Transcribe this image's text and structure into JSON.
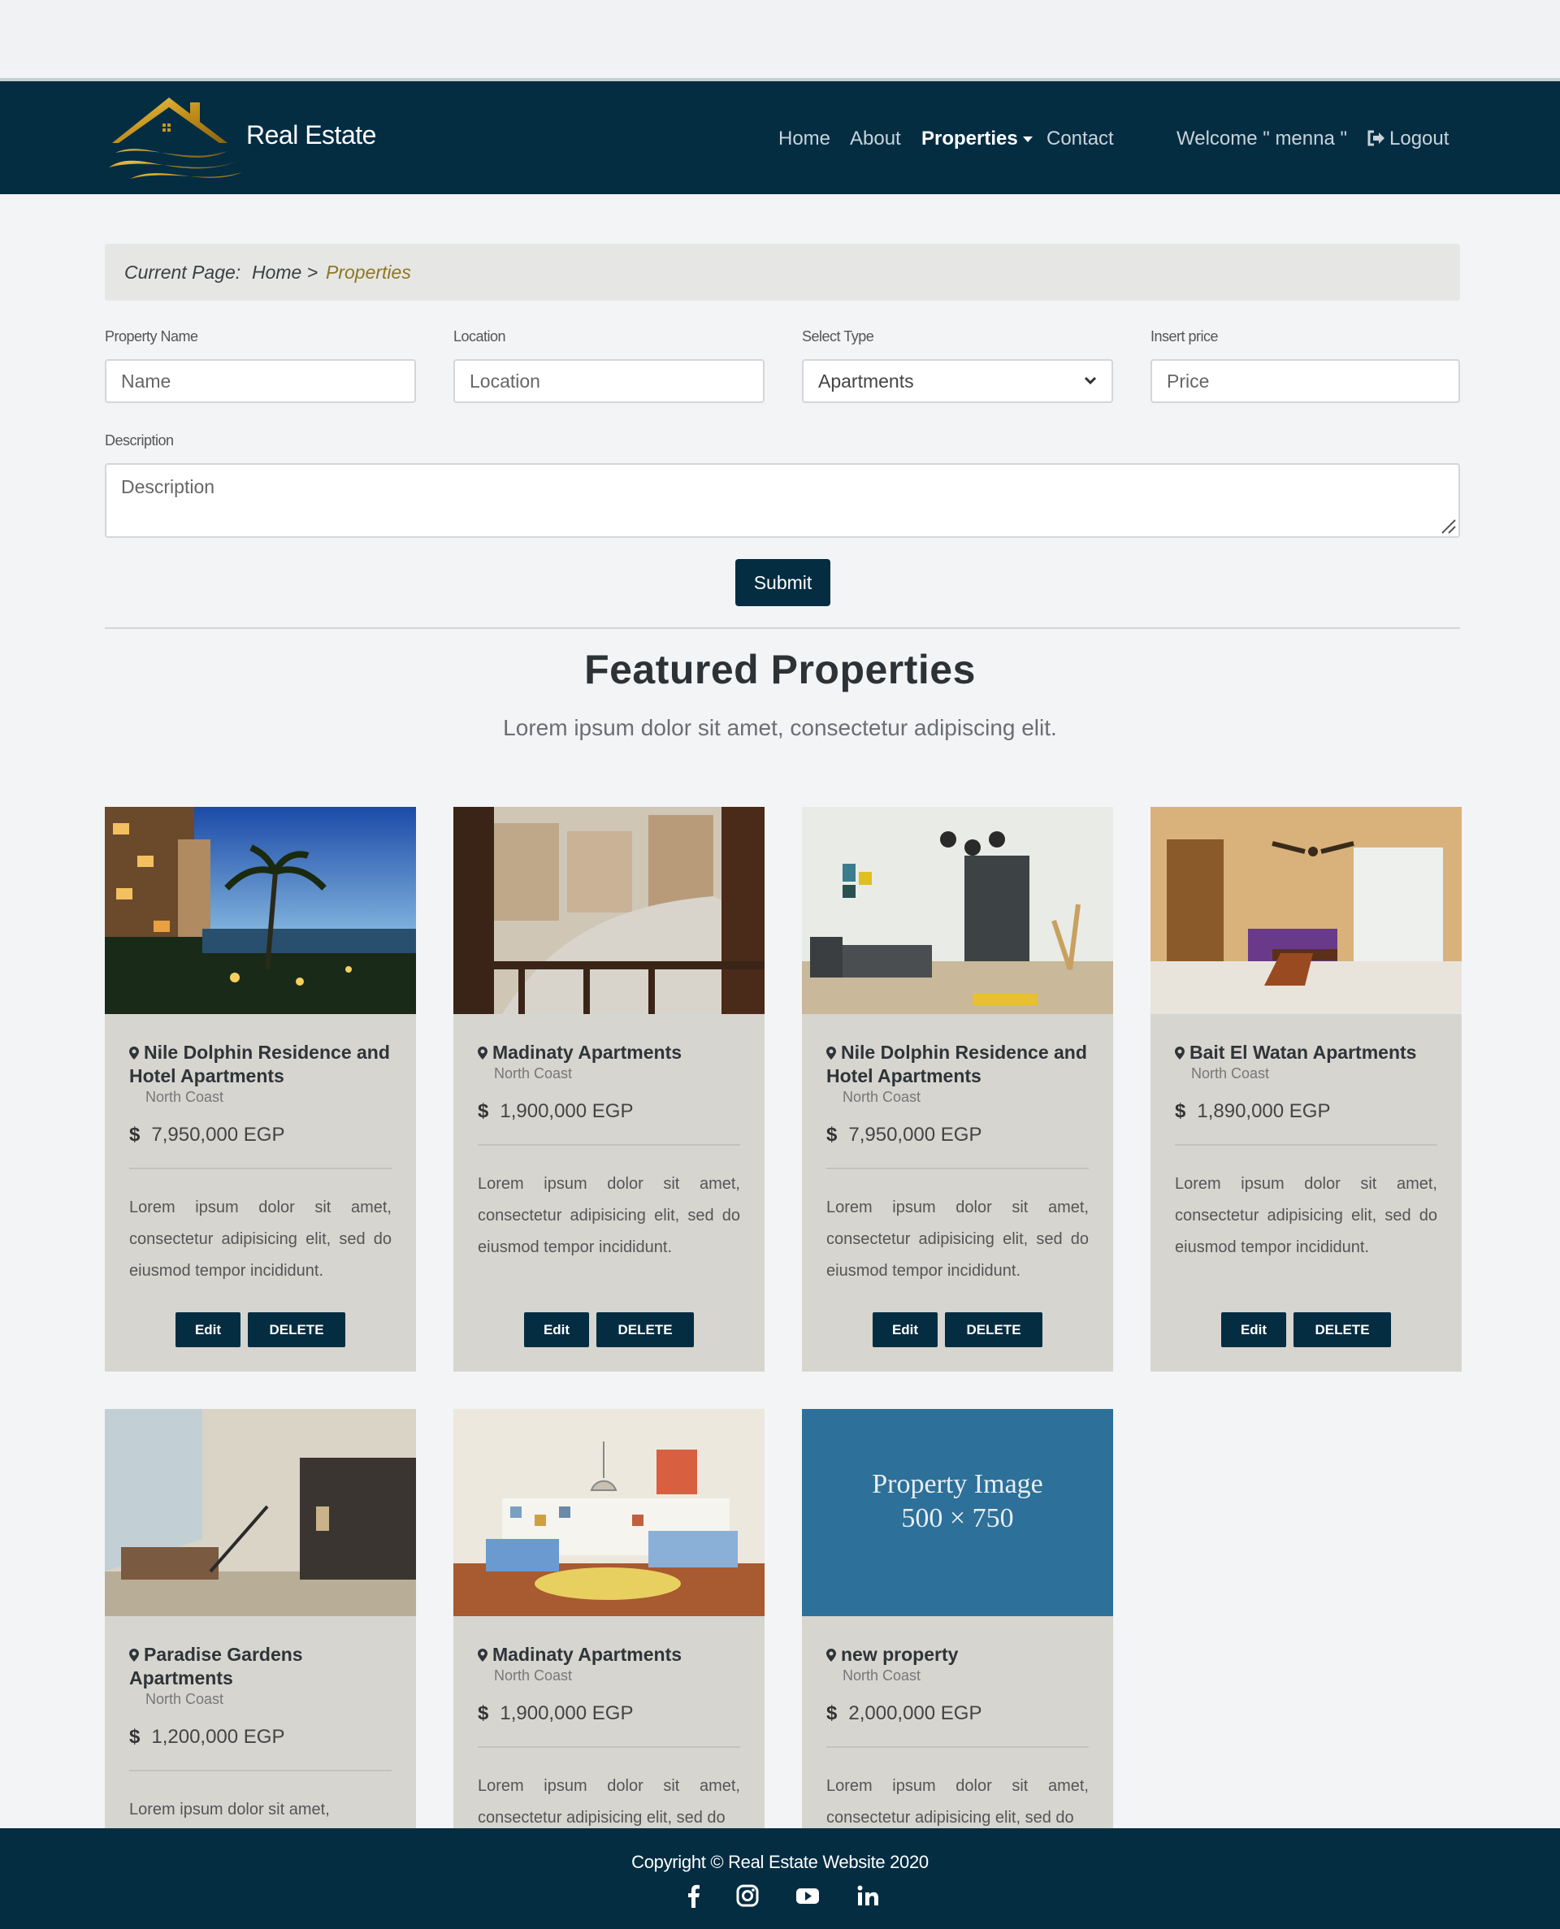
{
  "header": {
    "brand": "Real Estate",
    "nav": [
      "Home",
      "About",
      "Properties",
      "Contact"
    ],
    "welcome": "Welcome \" menna \"",
    "logout": "Logout"
  },
  "breadcrumb": {
    "prefix": "Current Page:",
    "home": "Home >",
    "current": "Properties"
  },
  "form": {
    "name_label": "Property Name",
    "name_placeholder": "Name",
    "location_label": "Location",
    "location_placeholder": "Location",
    "type_label": "Select Type",
    "type_value": "Apartments",
    "price_label": "Insert price",
    "price_placeholder": "Price",
    "description_label": "Description",
    "description_placeholder": "Description",
    "submit": "Submit"
  },
  "section": {
    "title": "Featured Properties",
    "subtitle": "Lorem ipsum dolor sit amet, consectetur adipiscing elit."
  },
  "cards": [
    {
      "title": "Nile Dolphin Residence and Hotel Apartments",
      "location": "North Coast",
      "price": "7,950,000 EGP",
      "desc": "Lorem ipsum dolor sit amet, consectetur adipisicing elit, sed do eiusmod tempor incididunt.",
      "edit": "Edit",
      "delete": "DELETE"
    },
    {
      "title": "Madinaty Apartments",
      "location": "North Coast",
      "price": "1,900,000 EGP",
      "desc": "Lorem ipsum dolor sit amet, consectetur adipisicing elit, sed do eiusmod tempor incididunt.",
      "edit": "Edit",
      "delete": "DELETE"
    },
    {
      "title": "Nile Dolphin Residence and Hotel Apartments",
      "location": "North Coast",
      "price": "7,950,000 EGP",
      "desc": "Lorem ipsum dolor sit amet, consectetur adipisicing elit, sed do eiusmod tempor incididunt.",
      "edit": "Edit",
      "delete": "DELETE"
    },
    {
      "title": "Bait El Watan Apartments",
      "location": "North Coast",
      "price": "1,890,000 EGP",
      "desc": "Lorem ipsum dolor sit amet, consectetur adipisicing elit, sed do eiusmod tempor incididunt.",
      "edit": "Edit",
      "delete": "DELETE"
    },
    {
      "title": "Paradise Gardens Apartments",
      "location": "North Coast",
      "price": "1,200,000 EGP",
      "desc": "Lorem ipsum dolor sit amet,"
    },
    {
      "title": "Madinaty Apartments",
      "location": "North Coast",
      "price": "1,900,000 EGP",
      "desc": "Lorem ipsum dolor sit amet, consectetur adipisicing elit, sed do"
    },
    {
      "title": "new property",
      "location": "North Coast",
      "price": "2,000,000 EGP",
      "desc": "Lorem ipsum dolor sit amet, consectetur adipisicing elit, sed do",
      "image_text": [
        "Property Image",
        "500 × 750"
      ]
    }
  ],
  "currency_symbol": "$",
  "footer": {
    "copyright": "Copyright © Real Estate Website 2020"
  },
  "colors": {
    "navy": "#042d42",
    "gold": "#c79a1e",
    "card": "#d6d5d0",
    "placeholder_blue": "#2d7099"
  }
}
